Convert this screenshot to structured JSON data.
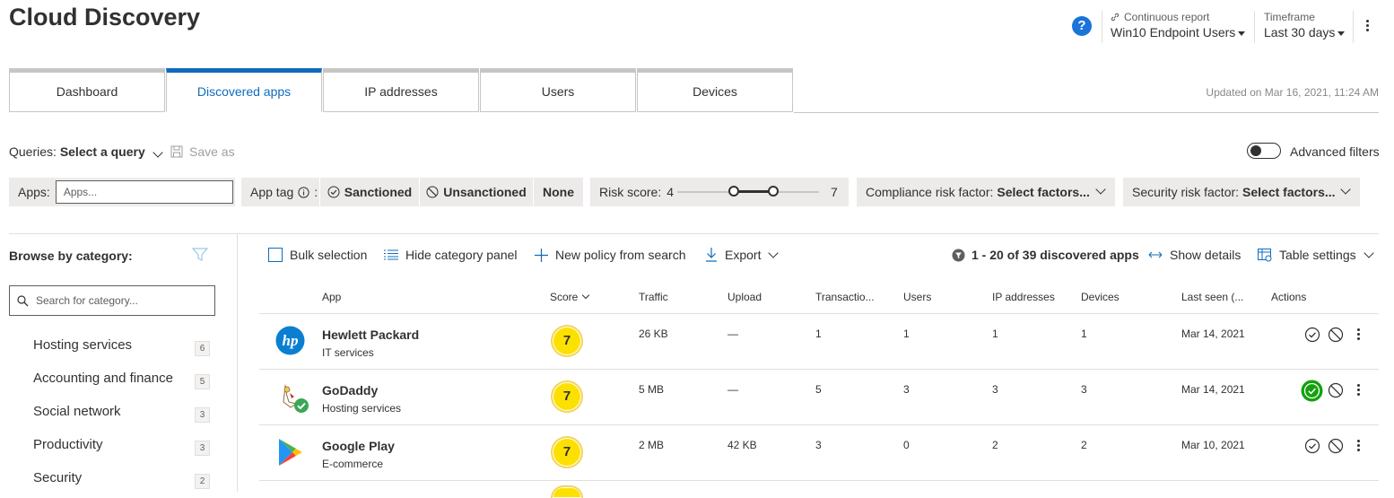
{
  "header": {
    "title": "Cloud Discovery",
    "help_icon": "help-icon",
    "report_label": "Continuous report",
    "report_value": "Win10 Endpoint Users",
    "timeframe_label": "Timeframe",
    "timeframe_value": "Last 30 days",
    "help_glyph": "?"
  },
  "tabs": [
    {
      "label": "Dashboard",
      "active": false
    },
    {
      "label": "Discovered apps",
      "active": true
    },
    {
      "label": "IP addresses",
      "active": false
    },
    {
      "label": "Users",
      "active": false
    },
    {
      "label": "Devices",
      "active": false
    }
  ],
  "updated_text": "Updated on Mar 16, 2021, 11:24 AM",
  "queries": {
    "label": "Queries:",
    "value": "Select a query",
    "save_as": "Save as",
    "advanced_filters": "Advanced filters",
    "advanced_filters_on": false
  },
  "filters": {
    "apps_label": "Apps:",
    "apps_placeholder": "Apps...",
    "app_tag_label": "App tag",
    "sanctioned": "Sanctioned",
    "unsanctioned": "Unsanctioned",
    "none": "None",
    "risk_label": "Risk score:",
    "risk_min": "4",
    "risk_max": "7",
    "compliance_label": "Compliance risk factor:",
    "compliance_value": "Select factors...",
    "security_label": "Security risk factor:",
    "security_value": "Select factors..."
  },
  "sidebar": {
    "title": "Browse by category:",
    "search_placeholder": "Search for category...",
    "categories": [
      {
        "label": "Hosting services",
        "count": "6"
      },
      {
        "label": "Accounting and finance",
        "count": "5"
      },
      {
        "label": "Social network",
        "count": "3"
      },
      {
        "label": "Productivity",
        "count": "3"
      },
      {
        "label": "Security",
        "count": "2"
      }
    ]
  },
  "toolbar": {
    "bulk_selection": "Bulk selection",
    "hide_category": "Hide category panel",
    "new_policy": "New policy from search",
    "export": "Export",
    "results": "1 - 20 of 39 discovered apps",
    "show_details": "Show details",
    "table_settings": "Table settings"
  },
  "table": {
    "columns": [
      "App",
      "Score",
      "Traffic",
      "Upload",
      "Transactio...",
      "Users",
      "IP addresses",
      "Devices",
      "Last seen (...",
      "Actions"
    ],
    "rows": [
      {
        "name": "Hewlett Packard",
        "category": "IT services",
        "score": "7",
        "traffic": "26 KB",
        "upload": "—",
        "transactions": "1",
        "users": "1",
        "ips": "1",
        "devices": "1",
        "last_seen": "Mar 14, 2021",
        "sanctioned": false,
        "logo": "hp-logo-icon"
      },
      {
        "name": "GoDaddy",
        "category": "Hosting services",
        "score": "7",
        "traffic": "5 MB",
        "upload": "—",
        "transactions": "5",
        "users": "3",
        "ips": "3",
        "devices": "3",
        "last_seen": "Mar 14, 2021",
        "sanctioned": true,
        "logo": "godaddy-logo-icon"
      },
      {
        "name": "Google Play",
        "category": "E-commerce",
        "score": "7",
        "traffic": "2 MB",
        "upload": "42 KB",
        "transactions": "3",
        "users": "0",
        "ips": "2",
        "devices": "2",
        "last_seen": "Mar 10, 2021",
        "sanctioned": false,
        "logo": "google-play-logo-icon"
      }
    ]
  },
  "colors": {
    "accent": "#0f6cbd",
    "score": "#fce100",
    "sanctioned": "#13a10e"
  }
}
